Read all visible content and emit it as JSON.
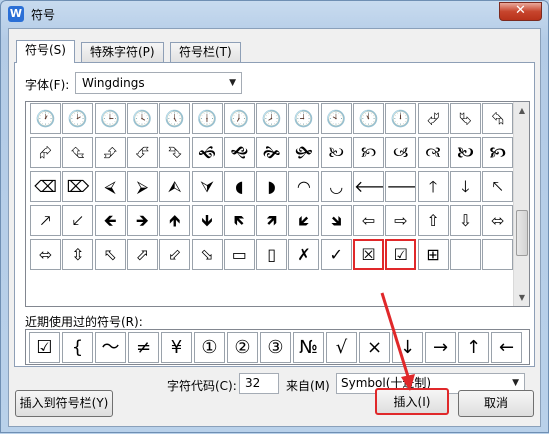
{
  "window": {
    "title": "符号",
    "app_icon": "W",
    "close_glyph": "✕"
  },
  "tabs": [
    {
      "label": "符号(S)",
      "active": true
    },
    {
      "label": "特殊字符(P)",
      "active": false
    },
    {
      "label": "符号栏(T)",
      "active": false
    }
  ],
  "font": {
    "label": "字体(F):",
    "value": "Wingdings"
  },
  "glyph_grid": [
    [
      "🕐",
      "🕑",
      "🕒",
      "🕓",
      "🕔",
      "🕕",
      "🕖",
      "🕗",
      "🕘",
      "🕙",
      "🕚",
      "🕛",
      "⮰",
      "⮱",
      "⮲"
    ],
    [
      "⮳",
      "⮴",
      "⮵",
      "⮶",
      "⮷",
      "🙜",
      "🙝",
      "🙞",
      "🙟",
      "🙠",
      "🙡",
      "🙢",
      "🙣",
      "🙤",
      "🙥"
    ],
    [
      "⌫",
      "⌦",
      "⮘",
      "⮚",
      "⮙",
      "⮛",
      "◖",
      "◗",
      "◠",
      "◡",
      "🡐",
      "🡒",
      "🡑",
      "🡓",
      "🡔"
    ],
    [
      "🡕",
      "🡗",
      "🡸",
      "🡺",
      "🡹",
      "🡻",
      "🡼",
      "🡽",
      "🡿",
      "🡾",
      "⇦",
      "⇨",
      "⇧",
      "⇩",
      "⬄"
    ],
    [
      "⬄",
      "⇳",
      "⬁",
      "⬀",
      "⬃",
      "⬂",
      "▭",
      "▯",
      "✗",
      "✓",
      "☒",
      "☑",
      "⊞",
      "",
      ""
    ]
  ],
  "highlighted_cells": [
    "4-10",
    "4-11"
  ],
  "recent": {
    "label": "近期使用过的符号(R):",
    "items": [
      "☑",
      "{",
      "～",
      "≠",
      "¥",
      "①",
      "②",
      "③",
      "№",
      "√",
      "×",
      "↓",
      "→",
      "↑",
      "←"
    ]
  },
  "char_code": {
    "label": "字符代码(C):",
    "value": "32"
  },
  "from": {
    "label": "来自(M)",
    "value": "Symbol(十进制)"
  },
  "buttons": {
    "add_to_bar": "插入到符号栏(Y)",
    "insert": "插入(I)",
    "cancel": "取消"
  },
  "colors": {
    "highlight_red": "#e0282a"
  }
}
